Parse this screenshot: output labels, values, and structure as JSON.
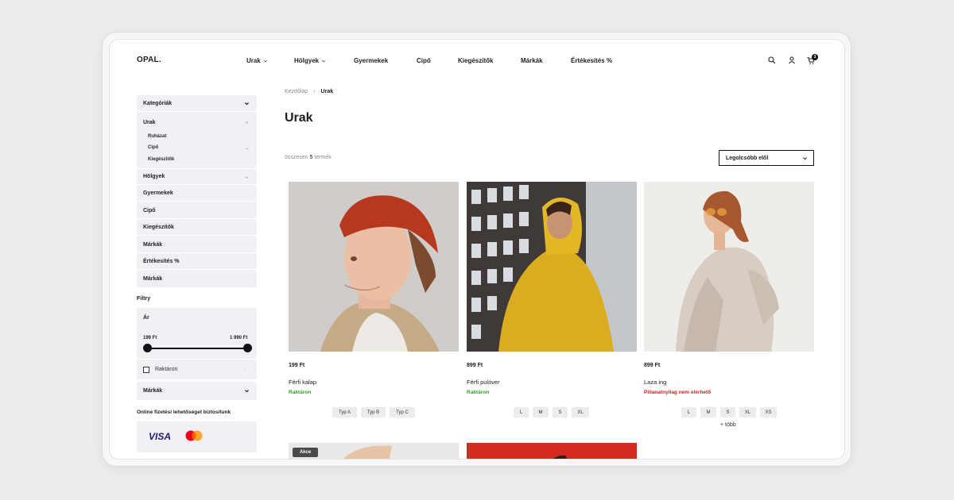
{
  "header": {
    "logo": "OPAL.",
    "nav": [
      {
        "label": "Urak",
        "has_dropdown": true
      },
      {
        "label": "Hölgyek",
        "has_dropdown": true
      },
      {
        "label": "Gyermekek",
        "has_dropdown": false
      },
      {
        "label": "Cipő",
        "has_dropdown": false
      },
      {
        "label": "Kiegészítők",
        "has_dropdown": false
      },
      {
        "label": "Márkák",
        "has_dropdown": false
      },
      {
        "label": "Értékesítés %",
        "has_dropdown": false
      }
    ],
    "icons": [
      "search-icon",
      "user-icon",
      "cart-icon"
    ],
    "cart_count": "3"
  },
  "sidebar": {
    "categories_title": "Kategóriák",
    "categories": [
      {
        "label": "Urak",
        "expanded": true,
        "sub": [
          {
            "label": "Ruházat"
          },
          {
            "label": "Cipő"
          },
          {
            "label": "Kiegészítők"
          }
        ]
      },
      {
        "label": "Hölgyek"
      },
      {
        "label": "Gyermekek"
      },
      {
        "label": "Cipő"
      },
      {
        "label": "Kiegészítők"
      },
      {
        "label": "Márkák"
      },
      {
        "label": "Értékesítés %"
      },
      {
        "label": "Márkák"
      }
    ],
    "filters_title": "Filtry",
    "price": {
      "label": "Ár",
      "min": "199 Ft",
      "max": "1 990 Ft"
    },
    "in_stock_label": "Raktáron",
    "brands_label": "Márkák",
    "payment_title": "Online fizetési lehetőséget biztosítunk",
    "payment_visa": "VISA"
  },
  "main": {
    "breadcrumb": {
      "home": "Kezdőlap",
      "current": "Urak"
    },
    "title": "Urak",
    "count_prefix": "összesen",
    "count_bold": "5",
    "count_suffix": "termék",
    "sort_label": "Legolcsóbb elől",
    "products": [
      {
        "price": "199 Ft",
        "name": "Férfi kalap",
        "stock": "Raktáron",
        "in_stock": true,
        "sizes": [
          "Typ A",
          "Typ B",
          "Typ C"
        ]
      },
      {
        "price": "899 Ft",
        "name": "Férfi pulóver",
        "stock": "Raktáron",
        "in_stock": true,
        "sizes": [
          "L",
          "M",
          "S",
          "XL"
        ]
      },
      {
        "price": "899 Ft",
        "name": "Laza ing",
        "stock": "Pillanatnyilag nem elérhető",
        "in_stock": false,
        "sizes": [
          "L",
          "M",
          "S",
          "XL",
          "XS"
        ],
        "more": "+ több"
      }
    ],
    "sale_badge": "Akce"
  },
  "colors": {
    "in_stock": "#2f9e23",
    "out_of_stock": "#d01c1c",
    "sidebar_bg": "#f1f1f5"
  }
}
